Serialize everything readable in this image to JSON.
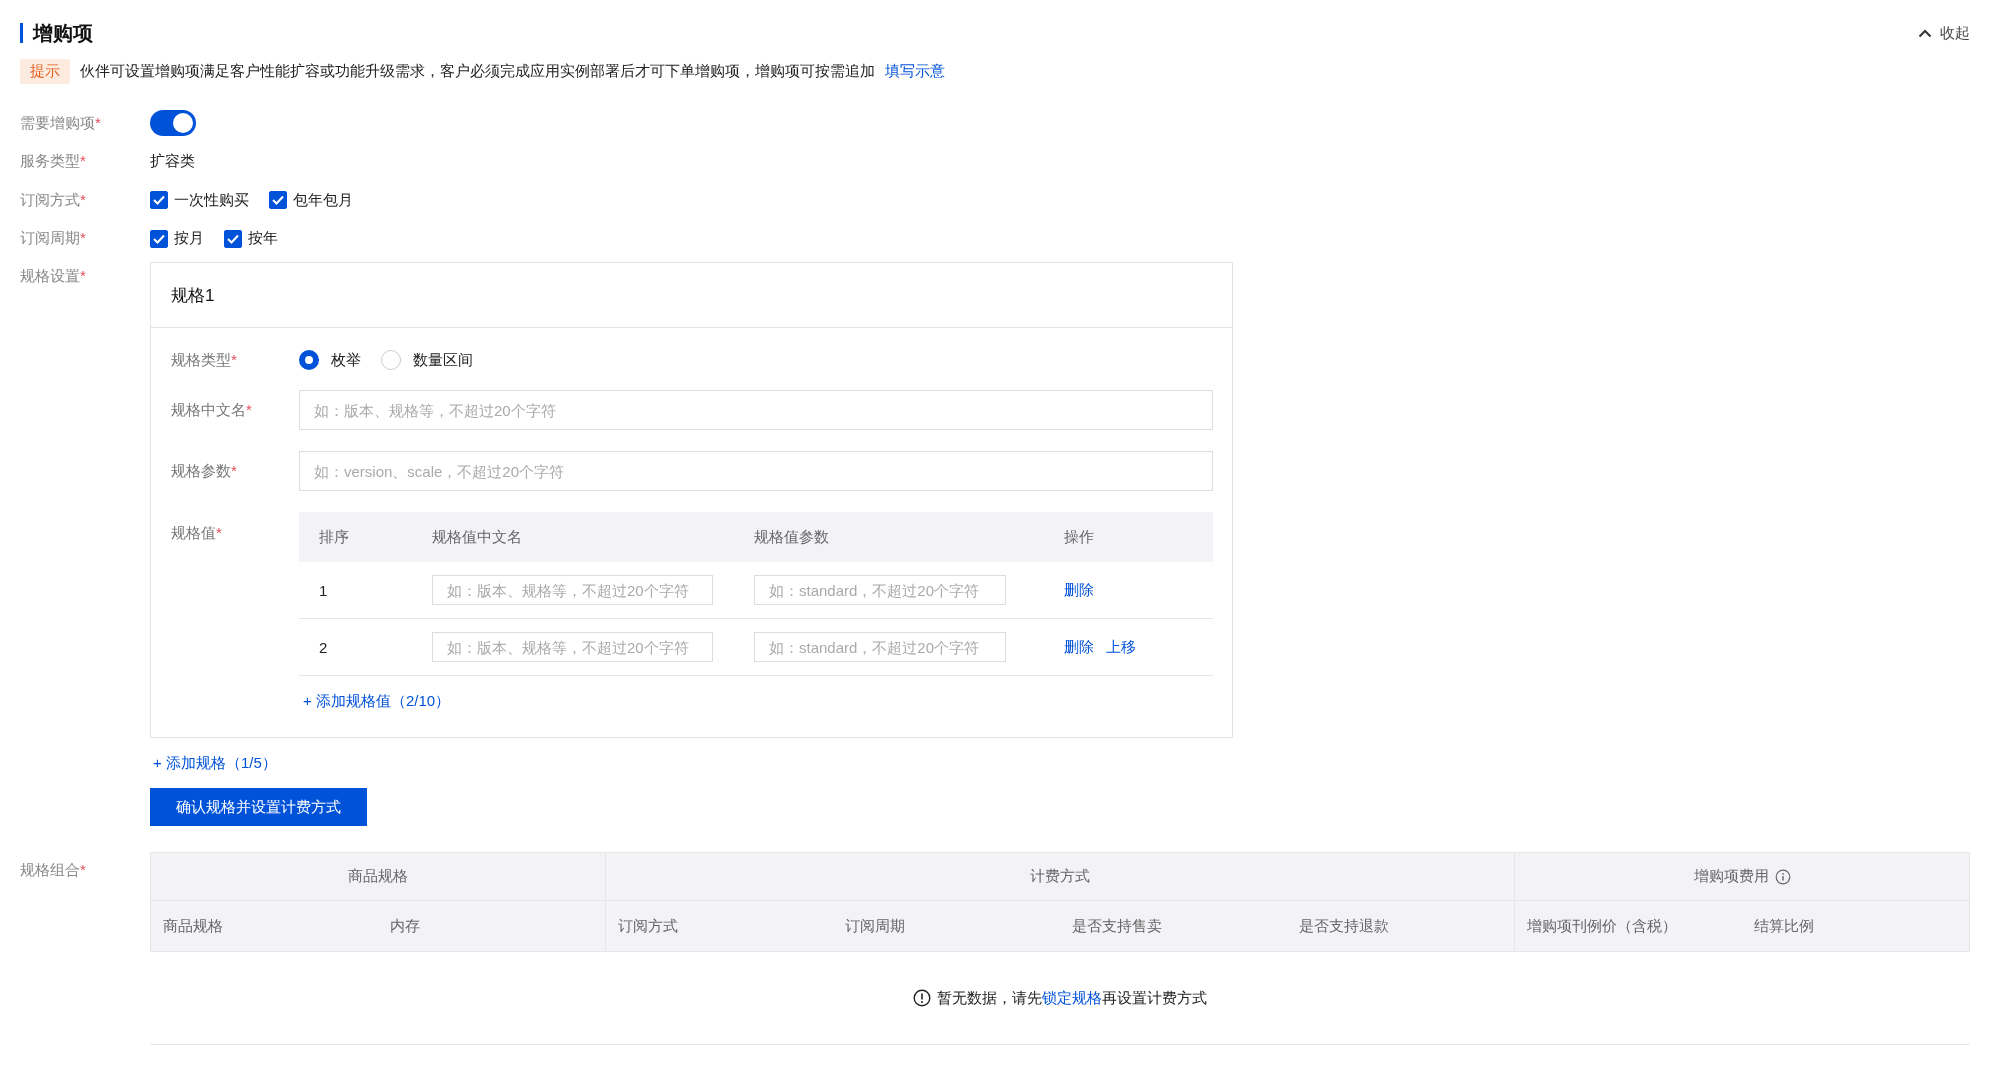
{
  "section": {
    "title": "增购项",
    "collapse_label": "收起"
  },
  "tip": {
    "badge": "提示",
    "text": "伙伴可设置增购项满足客户性能扩容或功能升级需求，客户必须完成应用实例部署后才可下单增购项，增购项可按需追加",
    "link": "填写示意"
  },
  "need_addon": {
    "label": "需要增购项",
    "required": "*",
    "on": true
  },
  "service_type": {
    "label": "服务类型",
    "required": "*",
    "value": "扩容类"
  },
  "subscription_method": {
    "label": "订阅方式",
    "required": "*",
    "options": [
      {
        "label": "一次性购买",
        "checked": true
      },
      {
        "label": "包年包月",
        "checked": true
      }
    ]
  },
  "subscription_period": {
    "label": "订阅周期",
    "required": "*",
    "options": [
      {
        "label": "按月",
        "checked": true
      },
      {
        "label": "按年",
        "checked": true
      }
    ]
  },
  "spec_settings": {
    "label": "规格设置",
    "required": "*",
    "specs": [
      {
        "title": "规格1",
        "type_field": {
          "label": "规格类型",
          "required": "*",
          "options": [
            {
              "label": "枚举",
              "selected": true
            },
            {
              "label": "数量区间",
              "selected": false
            }
          ]
        },
        "cn_name_field": {
          "label": "规格中文名",
          "required": "*",
          "placeholder": "如：版本、规格等，不超过20个字符"
        },
        "param_field": {
          "label": "规格参数",
          "required": "*",
          "placeholder": "如：version、scale，不超过20个字符"
        },
        "values": {
          "label": "规格值",
          "required": "*",
          "columns": [
            "排序",
            "规格值中文名",
            "规格值参数",
            "操作"
          ],
          "rows": [
            {
              "index": "1",
              "name_placeholder": "如：版本、规格等，不超过20个字符",
              "param_placeholder": "如：standard，不超过20个字符",
              "actions": [
                "删除"
              ]
            },
            {
              "index": "2",
              "name_placeholder": "如：版本、规格等，不超过20个字符",
              "param_placeholder": "如：standard，不超过20个字符",
              "actions": [
                "删除",
                "上移"
              ]
            }
          ],
          "add_link": "+ 添加规格值（2/10）"
        }
      }
    ],
    "add_spec_link": "+ 添加规格（1/5）",
    "confirm_button": "确认规格并设置计费方式"
  },
  "combination": {
    "label": "规格组合",
    "required": "*",
    "groups": [
      {
        "label": "商品规格",
        "info": false,
        "columns": [
          "商品规格",
          "内存"
        ]
      },
      {
        "label": "计费方式",
        "info": false,
        "columns": [
          "订阅方式",
          "订阅周期",
          "是否支持售卖",
          "是否支持退款"
        ]
      },
      {
        "label": "增购项费用",
        "info": true,
        "columns": [
          "增购项刊例价（含税）",
          "结算比例"
        ]
      }
    ],
    "empty": {
      "text_before": "暂无数据，请先",
      "link": "锁定规格",
      "text_after": "再设置计费方式"
    }
  }
}
